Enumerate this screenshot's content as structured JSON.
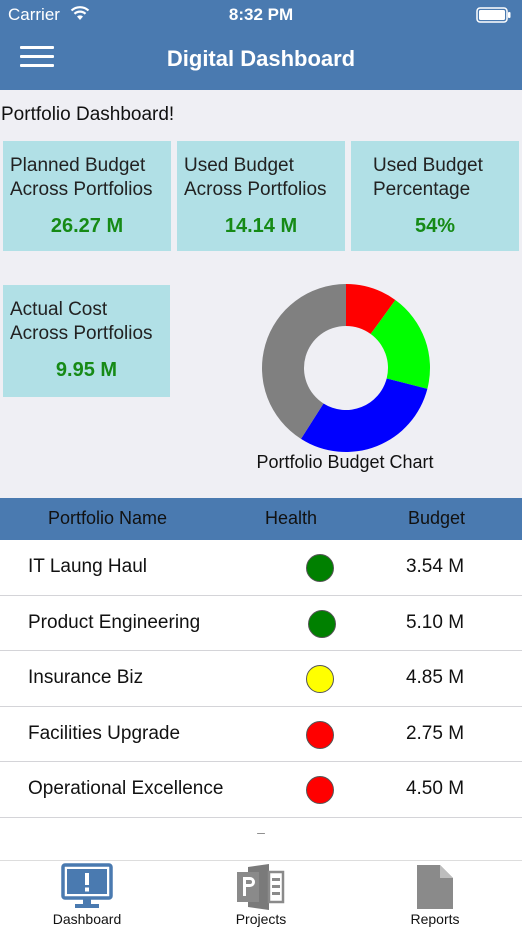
{
  "status_bar": {
    "carrier": "Carrier",
    "time": "8:32 PM"
  },
  "nav": {
    "title": "Digital Dashboard"
  },
  "heading": "Portfolio Dashboard!",
  "cards": [
    {
      "label_line1": "Planned Budget",
      "label_line2": "Across Portfolios",
      "value": "26.27 M"
    },
    {
      "label_line1": "Used Budget",
      "label_line2": "Across Portfolios",
      "value": "14.14 M"
    },
    {
      "label_line1": "Used Budget",
      "label_line2": "Percentage",
      "value": "54%"
    },
    {
      "label_line1": "Actual Cost",
      "label_line2": "Across Portfolios",
      "value": "9.95 M"
    }
  ],
  "chart_data": {
    "type": "pie",
    "title": "Portfolio Budget Chart",
    "slices": [
      {
        "value": 10,
        "color": "#ff0000"
      },
      {
        "value": 19,
        "color": "#00ff00"
      },
      {
        "value": 30,
        "color": "#0000ff"
      },
      {
        "value": 41,
        "color": "#808080"
      }
    ]
  },
  "table": {
    "headers": [
      "Portfolio Name",
      "Health",
      "Budget"
    ],
    "rows": [
      {
        "name": "IT Laung Haul",
        "health": "green",
        "health_color": "#008000",
        "budget": "3.54 M"
      },
      {
        "name": "Product Engineering",
        "health": "green",
        "health_color": "#008000",
        "budget": "5.10 M"
      },
      {
        "name": "Insurance Biz",
        "health": "yellow",
        "health_color": "#ffff00",
        "budget": "4.85 M"
      },
      {
        "name": "Facilities Upgrade",
        "health": "red",
        "health_color": "#ff0000",
        "budget": "2.75 M"
      },
      {
        "name": "Operational Excellence",
        "health": "red",
        "health_color": "#ff0000",
        "budget": "4.50 M"
      }
    ],
    "trailing_mark": "–"
  },
  "tabs": [
    {
      "label": "Dashboard",
      "icon": "monitor-icon",
      "active": true
    },
    {
      "label": "Projects",
      "icon": "project-file-icon",
      "active": false
    },
    {
      "label": "Reports",
      "icon": "document-icon",
      "active": false
    }
  ],
  "colors": {
    "nav": "#4a7ab0",
    "card": "#b1e0e6",
    "value": "#168a16"
  }
}
